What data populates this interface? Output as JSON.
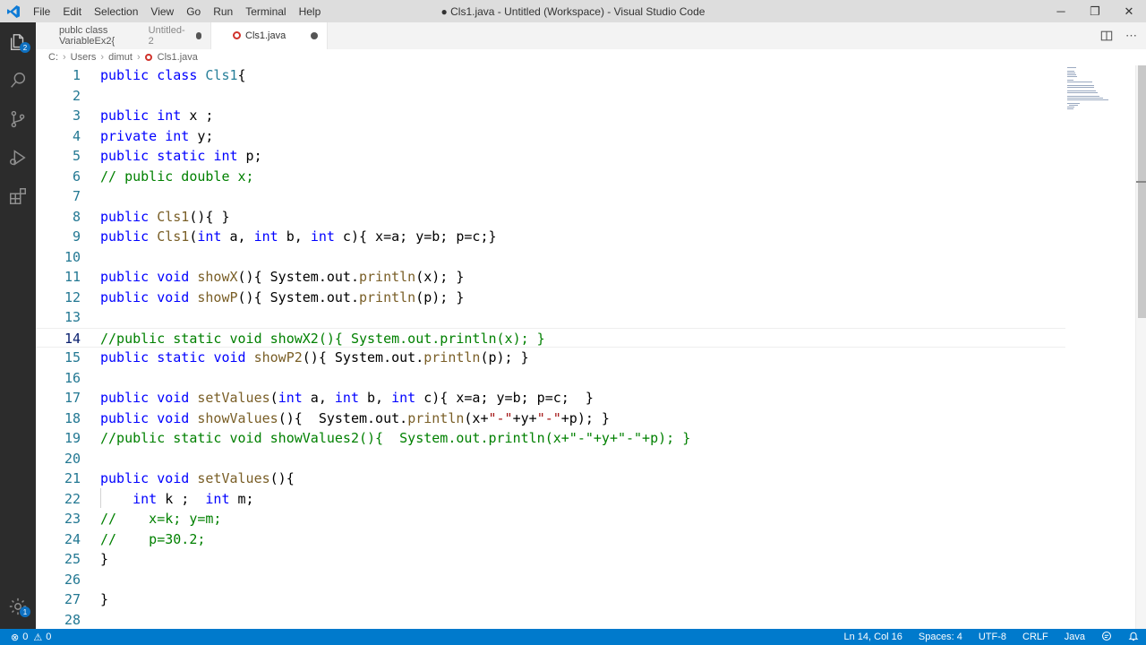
{
  "app": {
    "window_title": "● Cls1.java - Untitled (Workspace) - Visual Studio Code"
  },
  "menu": [
    "File",
    "Edit",
    "Selection",
    "View",
    "Go",
    "Run",
    "Terminal",
    "Help"
  ],
  "window_controls": {
    "minimize": "─",
    "restore": "❐",
    "close": "✕"
  },
  "activity_bar": {
    "items": [
      "explorer-icon",
      "search-icon",
      "source-control-icon",
      "run-debug-icon",
      "extensions-icon"
    ],
    "explorer_badge": "2",
    "manage_badge": "1"
  },
  "tabs": [
    {
      "label": "publc class VariableEx2{",
      "hint": "Untitled-2",
      "modified": true,
      "active": false
    },
    {
      "label": "Cls1.java",
      "hint": "",
      "modified": true,
      "active": true
    }
  ],
  "breadcrumb": [
    "C:",
    "Users",
    "dimut",
    "Cls1.java"
  ],
  "editor": {
    "current_line": 14,
    "lines": [
      {
        "n": "1",
        "html": "<span class=\"kw\">public</span> <span class=\"kw\">class</span> <span class=\"cls\">Cls1</span>{"
      },
      {
        "n": "2",
        "html": ""
      },
      {
        "n": "3",
        "html": "<span class=\"kw\">public</span> <span class=\"kw\">int</span> x ;"
      },
      {
        "n": "4",
        "html": "<span class=\"kw\">private</span> <span class=\"kw\">int</span> y;"
      },
      {
        "n": "5",
        "html": "<span class=\"kw\">public</span> <span class=\"kw\">static</span> <span class=\"kw\">int</span> p;"
      },
      {
        "n": "6",
        "html": "<span class=\"cm\">// public double x;</span>"
      },
      {
        "n": "7",
        "html": ""
      },
      {
        "n": "8",
        "html": "<span class=\"kw\">public</span> <span class=\"fn\">Cls1</span>(){ }"
      },
      {
        "n": "9",
        "html": "<span class=\"kw\">public</span> <span class=\"fn\">Cls1</span>(<span class=\"kw\">int</span> a, <span class=\"kw\">int</span> b, <span class=\"kw\">int</span> c){ x=a; y=b; p=c;}"
      },
      {
        "n": "10",
        "html": ""
      },
      {
        "n": "11",
        "html": "<span class=\"kw\">public</span> <span class=\"kw\">void</span> <span class=\"fn\">showX</span>(){ System.out.<span class=\"fn\">println</span>(x); }"
      },
      {
        "n": "12",
        "html": "<span class=\"kw\">public</span> <span class=\"kw\">void</span> <span class=\"fn\">showP</span>(){ System.out.<span class=\"fn\">println</span>(p); }"
      },
      {
        "n": "13",
        "html": ""
      },
      {
        "n": "14",
        "html": "<span class=\"cm\">//public static void showX2(){ System.out.println(x); }</span>"
      },
      {
        "n": "15",
        "html": "<span class=\"kw\">public</span> <span class=\"kw\">static</span> <span class=\"kw\">void</span> <span class=\"fn\">showP2</span>(){ System.out.<span class=\"fn\">println</span>(p); }"
      },
      {
        "n": "16",
        "html": ""
      },
      {
        "n": "17",
        "html": "<span class=\"kw\">public</span> <span class=\"kw\">void</span> <span class=\"fn\">setValues</span>(<span class=\"kw\">int</span> a, <span class=\"kw\">int</span> b, <span class=\"kw\">int</span> c){ x=a; y=b; p=c;  }"
      },
      {
        "n": "18",
        "html": "<span class=\"kw\">public</span> <span class=\"kw\">void</span> <span class=\"fn\">showValues</span>(){  System.out.<span class=\"fn\">println</span>(x+<span class=\"str\">\"-\"</span>+y+<span class=\"str\">\"-\"</span>+p); }"
      },
      {
        "n": "19",
        "html": "<span class=\"cm\">//public static void showValues2(){  System.out.println(x+\"-\"+y+\"-\"+p); }</span>"
      },
      {
        "n": "20",
        "html": ""
      },
      {
        "n": "21",
        "html": "<span class=\"kw\">public</span> <span class=\"kw\">void</span> <span class=\"fn\">setValues</span>(){"
      },
      {
        "n": "22",
        "html": "    <span class=\"kw\">int</span> k ;  <span class=\"kw\">int</span> m;"
      },
      {
        "n": "23",
        "html": "<span class=\"cm\">//    x=k; y=m;</span>"
      },
      {
        "n": "24",
        "html": "<span class=\"cm\">//    p=30.2;</span>"
      },
      {
        "n": "25",
        "html": "}"
      },
      {
        "n": "26",
        "html": ""
      },
      {
        "n": "27",
        "html": "}"
      },
      {
        "n": "28",
        "html": ""
      }
    ]
  },
  "status": {
    "errors": "0",
    "warnings": "0",
    "position": "Ln 14, Col 16",
    "spaces": "Spaces: 4",
    "encoding": "UTF-8",
    "eol": "CRLF",
    "language": "Java"
  },
  "colors": {
    "accent": "#007acc",
    "activity_bar": "#2c2c2c",
    "keyword": "#0000ff",
    "comment": "#008000",
    "function": "#795e26",
    "string": "#a31515"
  }
}
